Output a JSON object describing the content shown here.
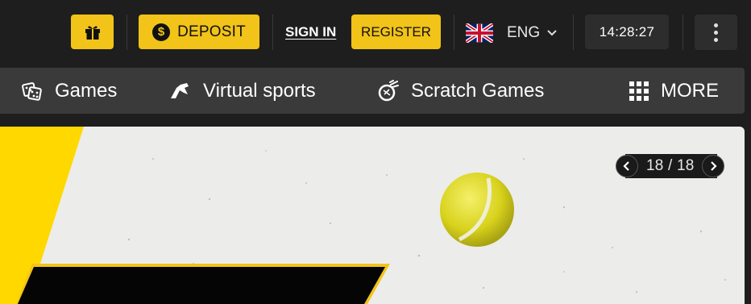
{
  "header": {
    "gift_icon": "gift-icon",
    "deposit_label": "DEPOSIT",
    "deposit_icon": "dollar-coin-icon",
    "signin_label": "SIGN IN",
    "register_label": "REGISTER",
    "language": {
      "label": "ENG",
      "flag_icon": "uk-flag-icon",
      "chevron_icon": "chevron-down-icon"
    },
    "clock": "14:28:27",
    "menu_icon": "kebab-menu-icon"
  },
  "nav": {
    "items": [
      {
        "label": "Games",
        "icon": "dice-icon"
      },
      {
        "label": "Virtual sports",
        "icon": "horse-icon"
      },
      {
        "label": "Scratch Games",
        "icon": "scratch-ball-icon"
      },
      {
        "label": "MORE",
        "icon": "grid-icon"
      }
    ]
  },
  "banner": {
    "slide_counter": "18 / 18",
    "prev_icon": "chevron-left-icon",
    "next_icon": "chevron-right-icon"
  },
  "colors": {
    "accent": "#f2c318",
    "background": "#1e1e1e",
    "nav_background": "#3a3a3a",
    "banner_background": "#ececea"
  }
}
